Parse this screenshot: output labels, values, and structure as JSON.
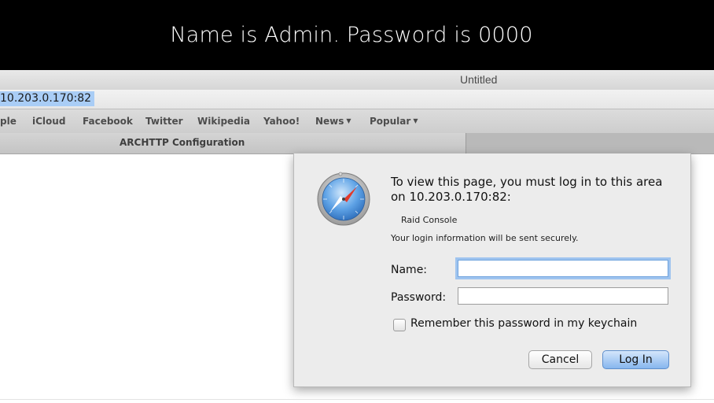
{
  "banner": {
    "text": "Name is Admin.  Password is 0000"
  },
  "window": {
    "title": "Untitled"
  },
  "address_bar": {
    "url": "10.203.0.170:82"
  },
  "bookmarks": [
    {
      "label": "ple"
    },
    {
      "label": "iCloud"
    },
    {
      "label": "Facebook"
    },
    {
      "label": "Twitter"
    },
    {
      "label": "Wikipedia"
    },
    {
      "label": "Yahoo!"
    },
    {
      "label": "News",
      "has_menu": true
    },
    {
      "label": "Popular",
      "has_menu": true
    }
  ],
  "tab": {
    "label": "ARCHTTP Configuration"
  },
  "auth_dialog": {
    "message": "To view this page, you must log in to this area on 10.203.0.170:82:",
    "realm": "Raid Console",
    "secure_note": "Your login information will be sent securely.",
    "name_label": "Name:",
    "name_value": "",
    "password_label": "Password:",
    "password_value": "",
    "remember_label": "Remember this password in my keychain",
    "remember_checked": false,
    "cancel_label": "Cancel",
    "login_label": "Log In"
  },
  "colors": {
    "banner_bg": "#000000",
    "url_highlight": "#a9cdf6",
    "focus_ring": "#9fc4ef",
    "default_button": "#87b6ee"
  }
}
